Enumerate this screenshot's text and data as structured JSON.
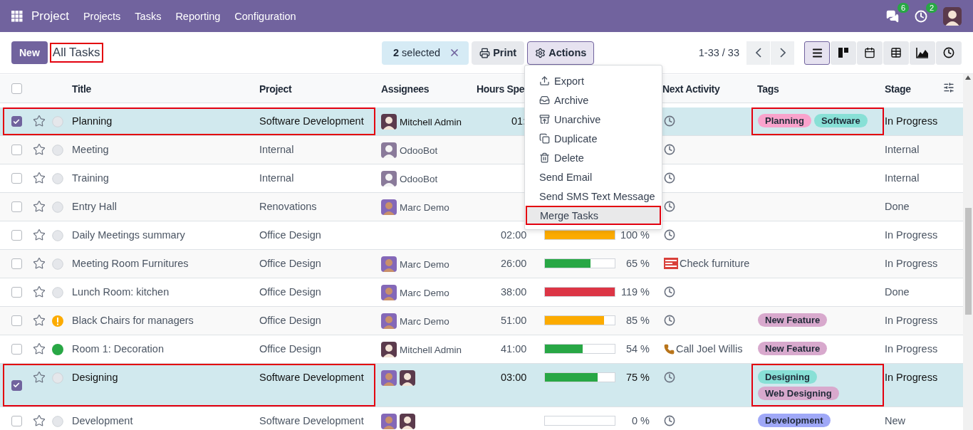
{
  "navbar": {
    "app": "Project",
    "menu": [
      "Projects",
      "Tasks",
      "Reporting",
      "Configuration"
    ],
    "messages_badge": "6",
    "activities_badge": "2"
  },
  "control_panel": {
    "new_button": "New",
    "breadcrumb": {
      "label": "All Tasks",
      "highlighted": true
    },
    "selection": "**2** selected",
    "print": "Print",
    "actions": "Actions",
    "pager": "1-33 / 33",
    "views": [
      {
        "kind": "list",
        "selected": true
      },
      {
        "kind": "kanban",
        "selected": false
      },
      {
        "kind": "calendar",
        "selected": false
      },
      {
        "kind": "pivot",
        "selected": false
      },
      {
        "kind": "graph",
        "selected": false
      },
      {
        "kind": "activity",
        "selected": false
      }
    ]
  },
  "actions_menu": [
    {
      "label": "Export",
      "highlighted": false
    },
    {
      "label": "Archive",
      "highlighted": false
    },
    {
      "label": "Unarchive",
      "highlighted": false
    },
    {
      "label": "Duplicate",
      "highlighted": false
    },
    {
      "label": "Delete",
      "highlighted": false
    },
    {
      "label": "Send Email",
      "highlighted": false
    },
    {
      "label": "Send SMS Text Message",
      "highlighted": false
    },
    {
      "label": "Merge Tasks",
      "highlighted": true
    }
  ],
  "table": {
    "select_all_checked": false,
    "columns": [
      "Title",
      "Project",
      "Assignees",
      "Hours Spe",
      "Next Activity",
      "Tags",
      "Stage"
    ],
    "rows": [
      {
        "selected": true,
        "highlighted": true,
        "kind": "normal",
        "title": "Planning",
        "project": "Software Development",
        "assignees": [
          {
            "kind": "admin",
            "name": "Mitchell Admin"
          }
        ],
        "hours": "01:",
        "activity": {
          "kind": "clock"
        },
        "tags": [
          {
            "label": "Planning",
            "color": "#f9a3cc"
          },
          {
            "label": "Software",
            "color": "#88e0d6"
          }
        ],
        "stage": "In Progress"
      },
      {
        "selected": false,
        "highlighted": false,
        "kind": "normal",
        "title": "Meeting",
        "project": "Internal",
        "assignees": [
          {
            "kind": "bot",
            "name": "OdooBot"
          }
        ],
        "activity": {
          "kind": "clock"
        },
        "stage": "Internal"
      },
      {
        "selected": false,
        "highlighted": false,
        "kind": "normal",
        "title": "Training",
        "project": "Internal",
        "assignees": [
          {
            "kind": "bot",
            "name": "OdooBot"
          }
        ],
        "activity": {
          "kind": "clock"
        },
        "stage": "Internal"
      },
      {
        "selected": false,
        "highlighted": false,
        "kind": "normal",
        "title": "Entry Hall",
        "project": "Renovations",
        "assignees": [
          {
            "kind": "marc",
            "name": "Marc Demo"
          }
        ],
        "activity": {
          "kind": "clock"
        },
        "stage": "Done"
      },
      {
        "selected": false,
        "highlighted": false,
        "kind": "normal",
        "title": "Daily Meetings summary",
        "project": "Office Design",
        "hours": "02:00",
        "progress": {
          "level": 1,
          "color": "#fcab00",
          "reading": "100 %"
        },
        "activity": {
          "kind": "clock"
        },
        "stage": "In Progress"
      },
      {
        "selected": false,
        "highlighted": false,
        "kind": "normal",
        "title": "Meeting Room Furnitures",
        "project": "Office Design",
        "assignees": [
          {
            "kind": "marc",
            "name": "Marc Demo"
          }
        ],
        "hours": "26:00",
        "progress": {
          "level": 0.65,
          "color": "#28a745",
          "reading": "65 %"
        },
        "activity": {
          "kind": "todo",
          "text": "Check furniture"
        },
        "stage": "In Progress"
      },
      {
        "selected": false,
        "highlighted": false,
        "kind": "normal",
        "title": "Lunch Room: kitchen",
        "project": "Office Design",
        "assignees": [
          {
            "kind": "marc",
            "name": "Marc Demo"
          }
        ],
        "hours": "38:00",
        "progress": {
          "level": 1,
          "color": "#dc3545",
          "reading": "119 %"
        },
        "activity": {
          "kind": "clock"
        },
        "stage": "Done"
      },
      {
        "selected": false,
        "highlighted": false,
        "kind": "warning",
        "title": "Black Chairs for managers",
        "project": "Office Design",
        "assignees": [
          {
            "kind": "marc",
            "name": "Marc Demo"
          }
        ],
        "hours": "51:00",
        "progress": {
          "level": 0.85,
          "color": "#fcab00",
          "reading": "85 %"
        },
        "activity": {
          "kind": "clock"
        },
        "tags": [
          {
            "label": "New Feature",
            "color": "#d8a9cd"
          }
        ],
        "stage": "In Progress"
      },
      {
        "selected": false,
        "highlighted": false,
        "kind": "done",
        "title": "Room 1: Decoration",
        "project": "Office Design",
        "assignees": [
          {
            "kind": "admin",
            "name": "Mitchell Admin"
          }
        ],
        "hours": "41:00",
        "progress": {
          "level": 0.54,
          "color": "#28a745",
          "reading": "54 %"
        },
        "activity": {
          "kind": "call",
          "text": "Call Joel Willis"
        },
        "tags": [
          {
            "label": "New Feature",
            "color": "#d8a9cd"
          }
        ],
        "stage": "In Progress"
      },
      {
        "selected": true,
        "highlighted": true,
        "kind": "normal",
        "title": "Designing",
        "project": "Software Development",
        "assignees": [
          {
            "kind": "marc"
          },
          {
            "kind": "admin"
          }
        ],
        "hours": "03:00",
        "progress": {
          "level": 0.75,
          "color": "#28a745",
          "reading": "75 %"
        },
        "activity": {
          "kind": "clock"
        },
        "tags": [
          {
            "label": "Designing",
            "color": "#88e0d6"
          },
          {
            "label": "Web Designing",
            "color": "#d8a9cd"
          }
        ],
        "stage": "In Progress"
      },
      {
        "selected": false,
        "highlighted": false,
        "kind": "normal",
        "title": "Development",
        "project": "Software Development",
        "assignees": [
          {
            "kind": "marc"
          },
          {
            "kind": "admin"
          }
        ],
        "progress": {
          "level": 0,
          "reading": "0 %"
        },
        "activity": {
          "kind": "clock"
        },
        "tags": [
          {
            "label": "Development",
            "color": "#9fa8f7"
          }
        ],
        "stage": "New"
      }
    ]
  }
}
